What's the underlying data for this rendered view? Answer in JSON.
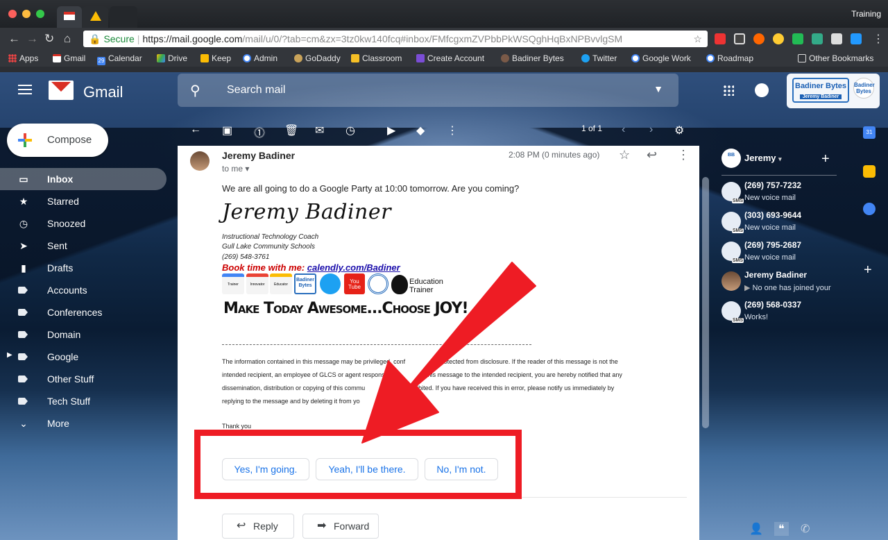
{
  "browser": {
    "window_title": "Training",
    "url_secure_label": "Secure",
    "url_host": "https://mail.google.com",
    "url_path": "/mail/u/0/?tab=cm&zx=3tz0kw140fcq#inbox/FMfcgxmZVPbbPkWSQghHqBxNPBvvlgSM",
    "bookmarks": [
      "Apps",
      "Gmail",
      "Calendar",
      "Drive",
      "Keep",
      "Admin",
      "GoDaddy",
      "Classroom",
      "Create Account",
      "Badiner Bytes",
      "Twitter",
      "Google Work",
      "Roadmap",
      "Other Bookmarks"
    ],
    "calendar_day": "29"
  },
  "gmail": {
    "product": "Gmail",
    "search_placeholder": "Search mail",
    "account_badge": "Badiner Bytes",
    "account_badge_sub": "Jeremy Badiner",
    "account_badge_small": "Badiner Bytes"
  },
  "sidebar": {
    "compose_label": "Compose",
    "items": [
      {
        "label": "Inbox",
        "icon": "inbox-icon"
      },
      {
        "label": "Starred",
        "icon": "star-icon"
      },
      {
        "label": "Snoozed",
        "icon": "clock-icon"
      },
      {
        "label": "Sent",
        "icon": "send-icon"
      },
      {
        "label": "Drafts",
        "icon": "draft-icon"
      },
      {
        "label": "Accounts",
        "icon": "label-icon"
      },
      {
        "label": "Conferences",
        "icon": "label-icon"
      },
      {
        "label": "Domain",
        "icon": "label-icon"
      },
      {
        "label": "Google",
        "icon": "label-icon"
      },
      {
        "label": "Other Stuff",
        "icon": "label-icon"
      },
      {
        "label": "Tech Stuff",
        "icon": "label-icon"
      },
      {
        "label": "More",
        "icon": "chevron-down-icon"
      }
    ]
  },
  "toolbar": {
    "pagination": "1 of 1"
  },
  "email": {
    "sender": "Jeremy Badiner",
    "to": "to me",
    "time": "2:08 PM (0 minutes ago)",
    "body": "We are all going to do a Google Party at 10:00 tomorrow. Are you coming?",
    "signature_name": "Jeremy Badiner",
    "sig_title": "Instructional Technology Coach",
    "sig_org": "Gull Lake Community Schools",
    "sig_phone": "(269) 548-3761",
    "book_prefix": "Book time with me: ",
    "book_link": "calendly.com/Badiner",
    "badges": [
      "Trainer",
      "Innovator",
      "Educator",
      "Badiner Bytes",
      "You Tube",
      "Education Trainer"
    ],
    "motto": "Make Today Awesome...Choose JOY!",
    "disclaimer_1": "The information contained in this message may be privileged, conf",
    "disclaimer_1b": "d protected from disclosure. If the reader of this message is not the",
    "disclaimer_2": "intended recipient, an employee of GLCS or agent responsible",
    "disclaimer_2b": "g this message to the intended recipient, you are hereby notified that any",
    "disclaimer_3": "dissemination, distribution or copying of this commu",
    "disclaimer_3b": "y prohibited.  If you have received this in error, please notify us immediately by",
    "disclaimer_4": "replying to the message and by deleting it from yo",
    "thanks": "Thank you",
    "smart_replies": [
      "Yes, I'm going.",
      "Yeah, I'll be there.",
      "No, I'm not."
    ],
    "reply_label": "Reply",
    "forward_label": "Forward"
  },
  "hangouts": {
    "user": "Jeremy",
    "contacts": [
      {
        "name": "(269) 757-7232",
        "status": "New voice mail",
        "type": "sms"
      },
      {
        "name": "(303) 693-9644",
        "status": "New voice mail",
        "type": "sms"
      },
      {
        "name": "(269) 795-2687",
        "status": "New voice mail",
        "type": "sms"
      },
      {
        "name": "Jeremy Badiner",
        "status": "No one has joined your",
        "type": "person"
      },
      {
        "name": "(269) 568-0337",
        "status": "Works!",
        "type": "sms"
      }
    ],
    "sms_tag": "SMS"
  },
  "colors": {
    "annotation_red": "#ee1c24",
    "link_blue": "#1a73e8",
    "gmail_red": "#d93025"
  }
}
